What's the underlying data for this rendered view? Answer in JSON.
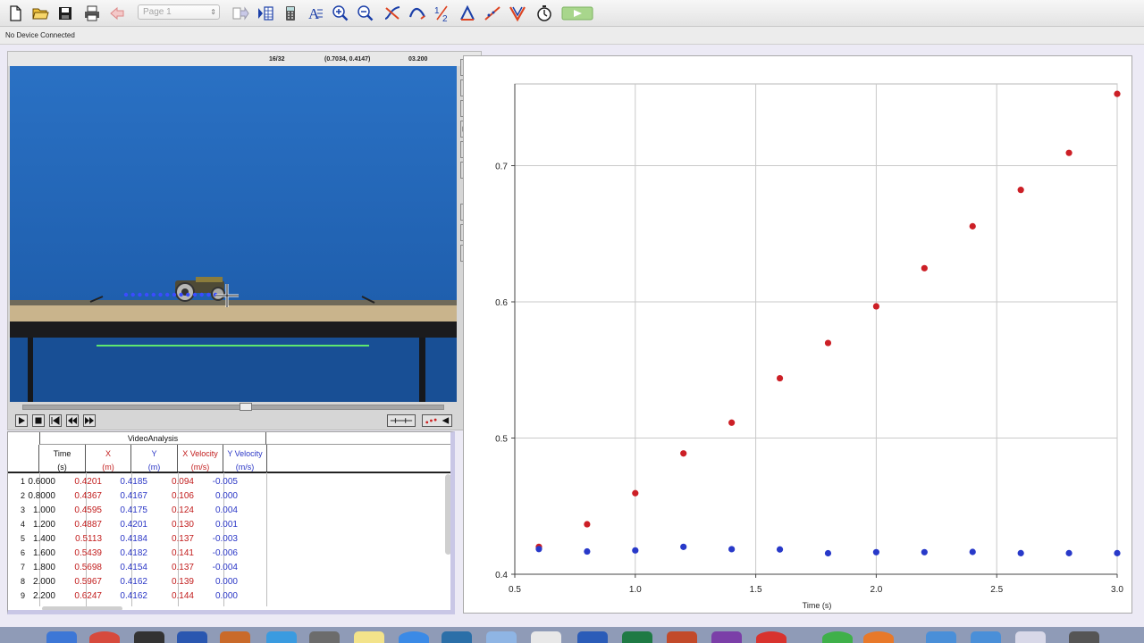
{
  "toolbar": {
    "page_select": "Page 1",
    "icons": [
      "new-file-icon",
      "open-folder-icon",
      "save-icon",
      "print-icon",
      "back-icon",
      "page-select",
      "forward-icon",
      "table-view-icon",
      "calculator-icon",
      "text-annotation-icon",
      "zoom-in-icon",
      "zoom-out-icon",
      "tangent-icon",
      "curve-fit-icon",
      "half-icon",
      "integral-icon",
      "linear-fit-icon",
      "model-icon",
      "stopwatch-icon",
      "collect-button"
    ]
  },
  "status": {
    "device": "No Device Connected"
  },
  "video": {
    "frame": "16/32",
    "coords": "(0.7034, 0.4147)",
    "time": "03.200"
  },
  "table": {
    "group": "VideoAnalysis",
    "columns": [
      {
        "name": "Time",
        "unit": "(s)",
        "color": "#111111"
      },
      {
        "name": "X",
        "unit": "(m)",
        "color": "#c21d1d"
      },
      {
        "name": "Y",
        "unit": "(m)",
        "color": "#2a36c6"
      },
      {
        "name": "X Velocity",
        "unit": "(m/s)",
        "color": "#c21d1d"
      },
      {
        "name": "Y Velocity",
        "unit": "(m/s)",
        "color": "#2a36c6"
      }
    ],
    "rows": [
      {
        "n": "1",
        "time": "0.6000",
        "x": "0.4201",
        "y": "0.4185",
        "vx": "0.094",
        "vy": "-0.005"
      },
      {
        "n": "2",
        "time": "0.8000",
        "x": "0.4367",
        "y": "0.4167",
        "vx": "0.106",
        "vy": "0.000"
      },
      {
        "n": "3",
        "time": "1.000",
        "x": "0.4595",
        "y": "0.4175",
        "vx": "0.124",
        "vy": "0.004"
      },
      {
        "n": "4",
        "time": "1.200",
        "x": "0.4887",
        "y": "0.4201",
        "vx": "0.130",
        "vy": "0.001"
      },
      {
        "n": "5",
        "time": "1.400",
        "x": "0.5113",
        "y": "0.4184",
        "vx": "0.137",
        "vy": "-0.003"
      },
      {
        "n": "6",
        "time": "1.600",
        "x": "0.5439",
        "y": "0.4182",
        "vx": "0.141",
        "vy": "-0.006"
      },
      {
        "n": "7",
        "time": "1.800",
        "x": "0.5698",
        "y": "0.4154",
        "vx": "0.137",
        "vy": "-0.004"
      },
      {
        "n": "8",
        "time": "2.000",
        "x": "0.5967",
        "y": "0.4162",
        "vx": "0.139",
        "vy": "0.000"
      },
      {
        "n": "9",
        "time": "2.200",
        "x": "0.6247",
        "y": "0.4162",
        "vx": "0.144",
        "vy": "0.000"
      }
    ]
  },
  "chart_data": {
    "type": "scatter",
    "xlabel": "Time (s)",
    "ylabel": "",
    "xlim": [
      0.5,
      3.0
    ],
    "ylim": [
      0.4,
      0.76
    ],
    "x_ticks": [
      "0.5",
      "1.0",
      "1.5",
      "2.0",
      "2.5",
      "3.0"
    ],
    "y_ticks": [
      "0.4",
      "0.5",
      "0.6",
      "0.7"
    ],
    "grid": true,
    "series": [
      {
        "color": "#cc1f26",
        "x": [
          0.6,
          0.8,
          1.0,
          1.2,
          1.4,
          1.6,
          1.8,
          2.0,
          2.2,
          2.4,
          2.6,
          2.8,
          3.0
        ],
        "y": [
          0.4201,
          0.4367,
          0.4595,
          0.4887,
          0.5113,
          0.5439,
          0.5698,
          0.5967,
          0.6247,
          0.6555,
          0.6822,
          0.7094,
          0.7527
        ]
      },
      {
        "color": "#2839c9",
        "x": [
          0.6,
          0.8,
          1.0,
          1.2,
          1.4,
          1.6,
          1.8,
          2.0,
          2.2,
          2.4,
          2.6,
          2.8,
          3.0
        ],
        "y": [
          0.4185,
          0.4167,
          0.4175,
          0.4201,
          0.4184,
          0.4182,
          0.4154,
          0.4162,
          0.4162,
          0.4164,
          0.4155,
          0.4155,
          0.4155
        ]
      }
    ]
  }
}
